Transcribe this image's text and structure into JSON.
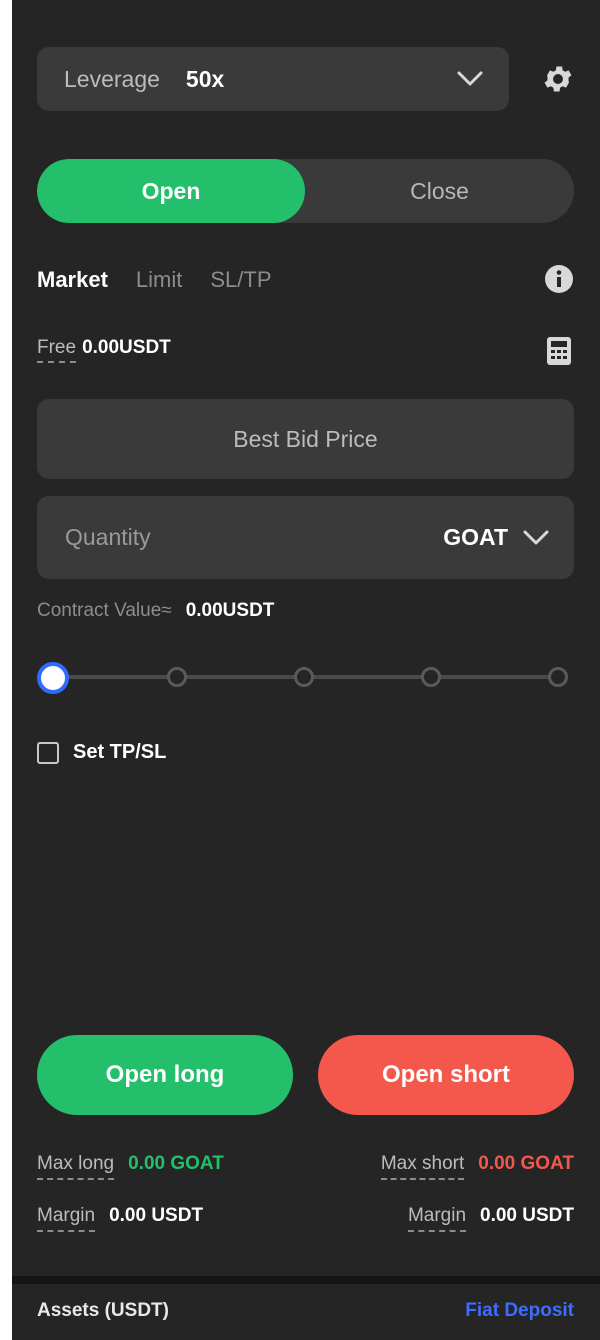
{
  "leverage": {
    "label": "Leverage",
    "value": "50x"
  },
  "mode": {
    "open_label": "Open",
    "close_label": "Close",
    "selected": "Open"
  },
  "order_tabs": [
    {
      "label": "Market",
      "active": true
    },
    {
      "label": "Limit",
      "active": false
    },
    {
      "label": "SL/TP",
      "active": false
    }
  ],
  "free": {
    "label": "Free",
    "value": "0.00USDT"
  },
  "price_field": {
    "placeholder": "Best Bid Price"
  },
  "quantity_field": {
    "placeholder": "Quantity",
    "unit": "GOAT"
  },
  "contract_value": {
    "label": "Contract Value≈",
    "value": "0.00USDT"
  },
  "slider": {
    "level_percent": 0,
    "steps": 5
  },
  "tpsl": {
    "label": "Set TP/SL",
    "checked": false
  },
  "actions": {
    "long_label": "Open long",
    "short_label": "Open short"
  },
  "stats": {
    "max_long": {
      "label": "Max long",
      "value": "0.00 GOAT"
    },
    "max_short": {
      "label": "Max short",
      "value": "0.00 GOAT"
    },
    "margin_long": {
      "label": "Margin",
      "value": "0.00 USDT"
    },
    "margin_short": {
      "label": "Margin",
      "value": "0.00 USDT"
    }
  },
  "footer": {
    "assets_label": "Assets (USDT)",
    "fiat_label": "Fiat Deposit"
  },
  "colors": {
    "buy": "#23bf6b",
    "sell": "#f4574b",
    "accent": "#2f6bff",
    "link": "#3d6cff"
  },
  "icons": [
    "chevron-down-icon",
    "gear-icon",
    "info-icon",
    "calculator-icon",
    "checkbox-icon"
  ]
}
